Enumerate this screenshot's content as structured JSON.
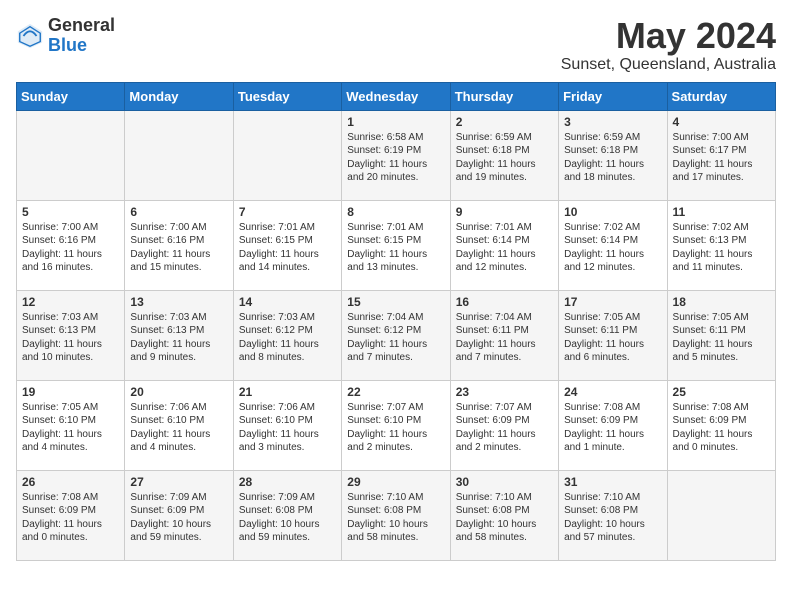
{
  "header": {
    "logo_general": "General",
    "logo_blue": "Blue",
    "title": "May 2024",
    "subtitle": "Sunset, Queensland, Australia"
  },
  "days_of_week": [
    "Sunday",
    "Monday",
    "Tuesday",
    "Wednesday",
    "Thursday",
    "Friday",
    "Saturday"
  ],
  "weeks": [
    [
      {
        "day": "",
        "info": ""
      },
      {
        "day": "",
        "info": ""
      },
      {
        "day": "",
        "info": ""
      },
      {
        "day": "1",
        "info": "Sunrise: 6:58 AM\nSunset: 6:19 PM\nDaylight: 11 hours\nand 20 minutes."
      },
      {
        "day": "2",
        "info": "Sunrise: 6:59 AM\nSunset: 6:18 PM\nDaylight: 11 hours\nand 19 minutes."
      },
      {
        "day": "3",
        "info": "Sunrise: 6:59 AM\nSunset: 6:18 PM\nDaylight: 11 hours\nand 18 minutes."
      },
      {
        "day": "4",
        "info": "Sunrise: 7:00 AM\nSunset: 6:17 PM\nDaylight: 11 hours\nand 17 minutes."
      }
    ],
    [
      {
        "day": "5",
        "info": "Sunrise: 7:00 AM\nSunset: 6:16 PM\nDaylight: 11 hours\nand 16 minutes."
      },
      {
        "day": "6",
        "info": "Sunrise: 7:00 AM\nSunset: 6:16 PM\nDaylight: 11 hours\nand 15 minutes."
      },
      {
        "day": "7",
        "info": "Sunrise: 7:01 AM\nSunset: 6:15 PM\nDaylight: 11 hours\nand 14 minutes."
      },
      {
        "day": "8",
        "info": "Sunrise: 7:01 AM\nSunset: 6:15 PM\nDaylight: 11 hours\nand 13 minutes."
      },
      {
        "day": "9",
        "info": "Sunrise: 7:01 AM\nSunset: 6:14 PM\nDaylight: 11 hours\nand 12 minutes."
      },
      {
        "day": "10",
        "info": "Sunrise: 7:02 AM\nSunset: 6:14 PM\nDaylight: 11 hours\nand 12 minutes."
      },
      {
        "day": "11",
        "info": "Sunrise: 7:02 AM\nSunset: 6:13 PM\nDaylight: 11 hours\nand 11 minutes."
      }
    ],
    [
      {
        "day": "12",
        "info": "Sunrise: 7:03 AM\nSunset: 6:13 PM\nDaylight: 11 hours\nand 10 minutes."
      },
      {
        "day": "13",
        "info": "Sunrise: 7:03 AM\nSunset: 6:13 PM\nDaylight: 11 hours\nand 9 minutes."
      },
      {
        "day": "14",
        "info": "Sunrise: 7:03 AM\nSunset: 6:12 PM\nDaylight: 11 hours\nand 8 minutes."
      },
      {
        "day": "15",
        "info": "Sunrise: 7:04 AM\nSunset: 6:12 PM\nDaylight: 11 hours\nand 7 minutes."
      },
      {
        "day": "16",
        "info": "Sunrise: 7:04 AM\nSunset: 6:11 PM\nDaylight: 11 hours\nand 7 minutes."
      },
      {
        "day": "17",
        "info": "Sunrise: 7:05 AM\nSunset: 6:11 PM\nDaylight: 11 hours\nand 6 minutes."
      },
      {
        "day": "18",
        "info": "Sunrise: 7:05 AM\nSunset: 6:11 PM\nDaylight: 11 hours\nand 5 minutes."
      }
    ],
    [
      {
        "day": "19",
        "info": "Sunrise: 7:05 AM\nSunset: 6:10 PM\nDaylight: 11 hours\nand 4 minutes."
      },
      {
        "day": "20",
        "info": "Sunrise: 7:06 AM\nSunset: 6:10 PM\nDaylight: 11 hours\nand 4 minutes."
      },
      {
        "day": "21",
        "info": "Sunrise: 7:06 AM\nSunset: 6:10 PM\nDaylight: 11 hours\nand 3 minutes."
      },
      {
        "day": "22",
        "info": "Sunrise: 7:07 AM\nSunset: 6:10 PM\nDaylight: 11 hours\nand 2 minutes."
      },
      {
        "day": "23",
        "info": "Sunrise: 7:07 AM\nSunset: 6:09 PM\nDaylight: 11 hours\nand 2 minutes."
      },
      {
        "day": "24",
        "info": "Sunrise: 7:08 AM\nSunset: 6:09 PM\nDaylight: 11 hours\nand 1 minute."
      },
      {
        "day": "25",
        "info": "Sunrise: 7:08 AM\nSunset: 6:09 PM\nDaylight: 11 hours\nand 0 minutes."
      }
    ],
    [
      {
        "day": "26",
        "info": "Sunrise: 7:08 AM\nSunset: 6:09 PM\nDaylight: 11 hours\nand 0 minutes."
      },
      {
        "day": "27",
        "info": "Sunrise: 7:09 AM\nSunset: 6:09 PM\nDaylight: 10 hours\nand 59 minutes."
      },
      {
        "day": "28",
        "info": "Sunrise: 7:09 AM\nSunset: 6:08 PM\nDaylight: 10 hours\nand 59 minutes."
      },
      {
        "day": "29",
        "info": "Sunrise: 7:10 AM\nSunset: 6:08 PM\nDaylight: 10 hours\nand 58 minutes."
      },
      {
        "day": "30",
        "info": "Sunrise: 7:10 AM\nSunset: 6:08 PM\nDaylight: 10 hours\nand 58 minutes."
      },
      {
        "day": "31",
        "info": "Sunrise: 7:10 AM\nSunset: 6:08 PM\nDaylight: 10 hours\nand 57 minutes."
      },
      {
        "day": "",
        "info": ""
      }
    ]
  ]
}
